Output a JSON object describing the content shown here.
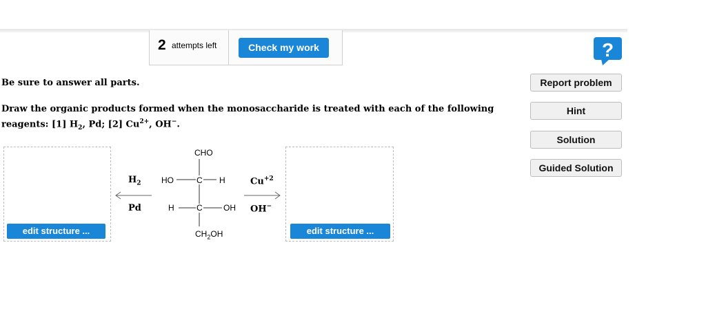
{
  "header": {
    "attempts_count": "2",
    "attempts_label": "attempts left",
    "check_label": "Check my work"
  },
  "help_icon": {
    "glyph": "?",
    "color": "#1a86d8"
  },
  "sidebar": {
    "report": "Report problem",
    "hint": "Hint",
    "solution": "Solution",
    "guided": "Guided Solution"
  },
  "question": {
    "instruction": "Be sure to answer all parts.",
    "line1": "Draw the organic products formed when the monosaccharide is treated with each of the following",
    "line2_prefix": "reagents: [1] H",
    "line2_sub": "2",
    "line2_mid": ", Pd; [2] Cu",
    "line2_sup1": "2+",
    "line2_mid2": ", OH",
    "line2_sup2": "−",
    "line2_end": "."
  },
  "left_panel": {
    "edit_label": "edit structure ...",
    "reagent_top_main": "H",
    "reagent_top_sub": "2",
    "reagent_bottom": "Pd"
  },
  "right_panel": {
    "edit_label": "edit structure ...",
    "reagent_top_main": "Cu",
    "reagent_top_sup": "+2",
    "reagent_bottom_main": "OH",
    "reagent_bottom_sup": "−"
  },
  "molecule": {
    "top_group": "CHO",
    "row1_left": "HO",
    "row1_center": "C",
    "row1_right": "H",
    "row2_left": "H",
    "row2_center": "C",
    "row2_right": "OH",
    "bottom_main": "CH",
    "bottom_sub": "2",
    "bottom_end": "OH"
  },
  "colors": {
    "accent": "#1a86d8",
    "button_bg": "#f0f0f0"
  }
}
